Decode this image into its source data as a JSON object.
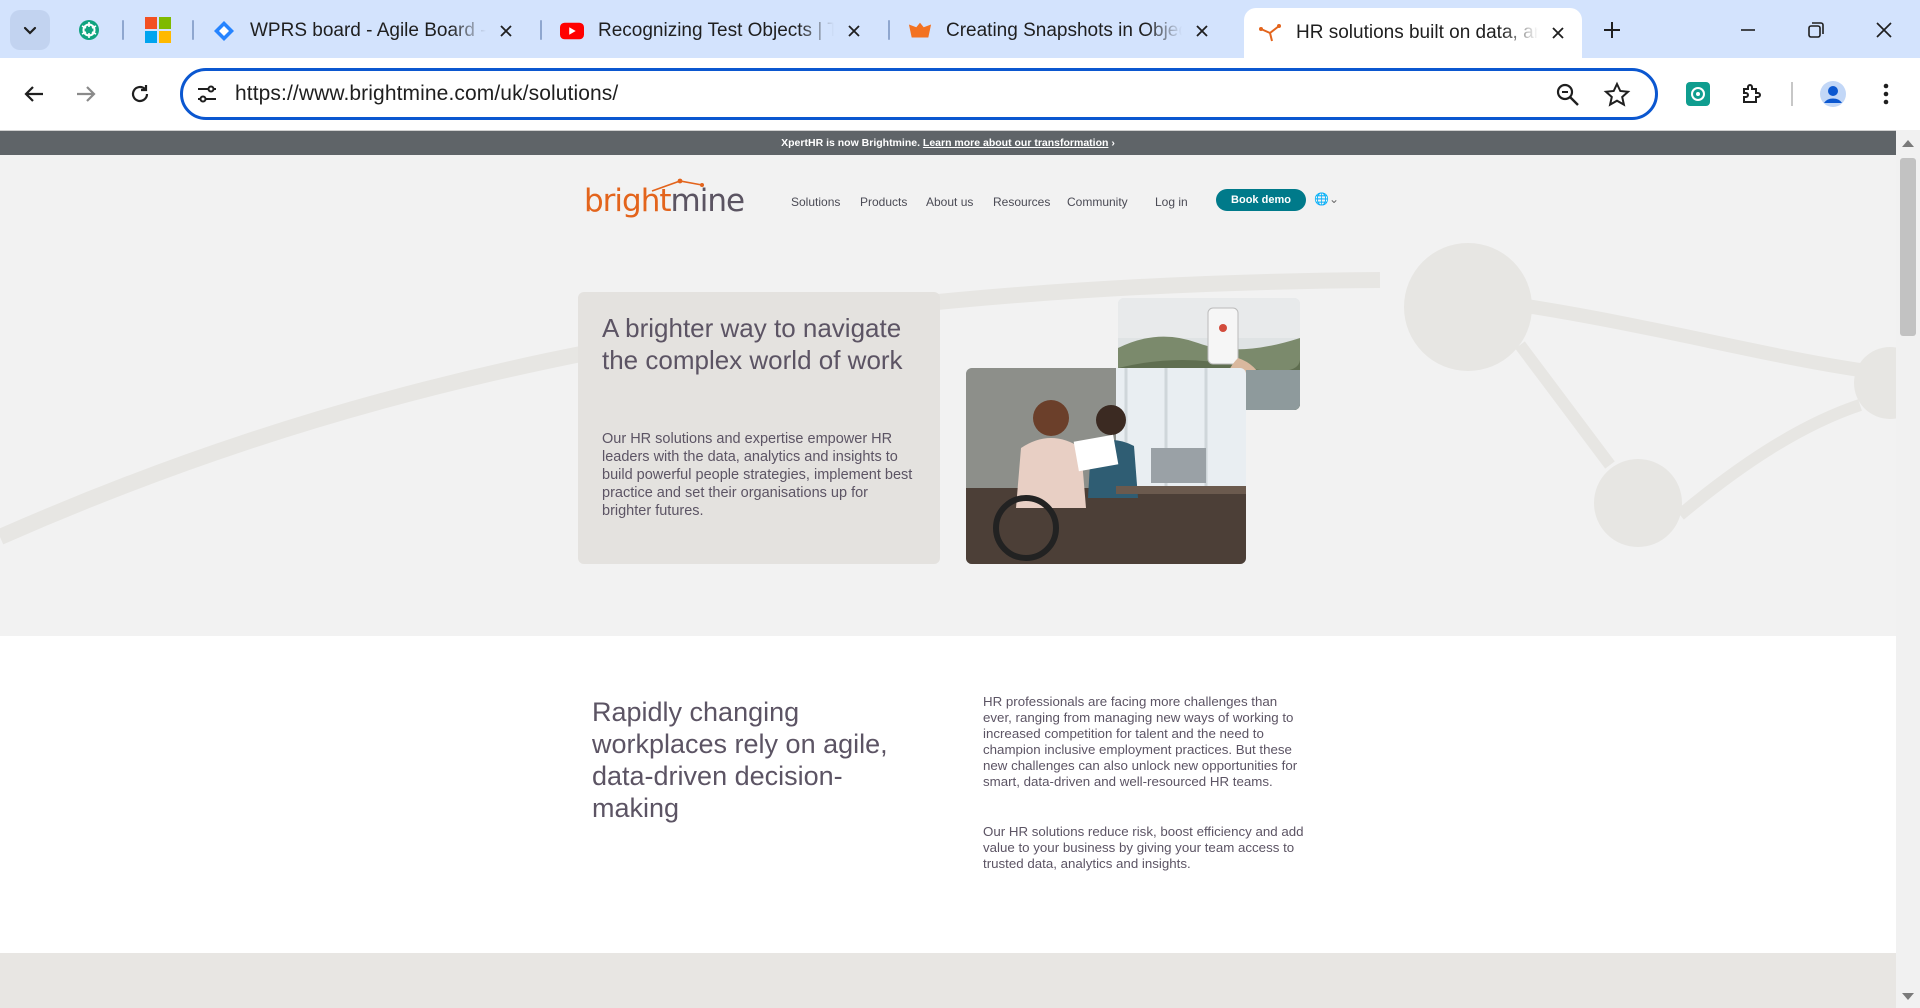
{
  "browser": {
    "tabs": [
      {
        "title": "WPRS board - Agile Board - C",
        "icon": "jira-icon"
      },
      {
        "title": "Recognizing Test Objects | Te",
        "icon": "youtube-icon"
      },
      {
        "title": "Creating Snapshots in Object",
        "icon": "smartbear-icon"
      },
      {
        "title": "HR solutions built on data, an",
        "icon": "brightmine-icon",
        "active": true
      }
    ],
    "pinned_tabs": [
      "chatgpt-icon",
      "microsoft-icon"
    ],
    "url": "https://www.brightmine.com/uk/solutions/"
  },
  "page": {
    "announcement": {
      "text": "XpertHR is now Brightmine. ",
      "link": "Learn more about our transformation",
      "arrow": "›"
    },
    "logo": {
      "part1": "bright",
      "part2": "mine"
    },
    "nav": {
      "items": [
        "Solutions",
        "Products",
        "About us",
        "Resources",
        "Community"
      ],
      "login": "Log in",
      "cta": "Book demo",
      "lang": "🌐⌄"
    },
    "hero": {
      "heading": "A brighter way to navigate the complex world of work",
      "body": "Our HR solutions and expertise empower HR leaders with the data, analytics and insights to build powerful people strategies, implement best practice and set their organisations up for brighter futures."
    },
    "section2": {
      "heading": "Rapidly changing workplaces rely on agile, data-driven decision-making",
      "para1": "HR professionals are facing more challenges than ever, ranging from managing new ways of working to increased competition for talent and the need to champion inclusive employment practices. But these new challenges can also unlock new opportunities for smart, data-driven and well-resourced HR teams.",
      "para2": "Our HR solutions reduce risk, boost efficiency and add value to your business by giving your team access to trusted data, analytics and insights."
    }
  },
  "colors": {
    "brand_orange": "#e3641c",
    "brand_purple": "#5b5462",
    "cta_teal": "#007a8a",
    "omnibox_border": "#0b57d0"
  }
}
